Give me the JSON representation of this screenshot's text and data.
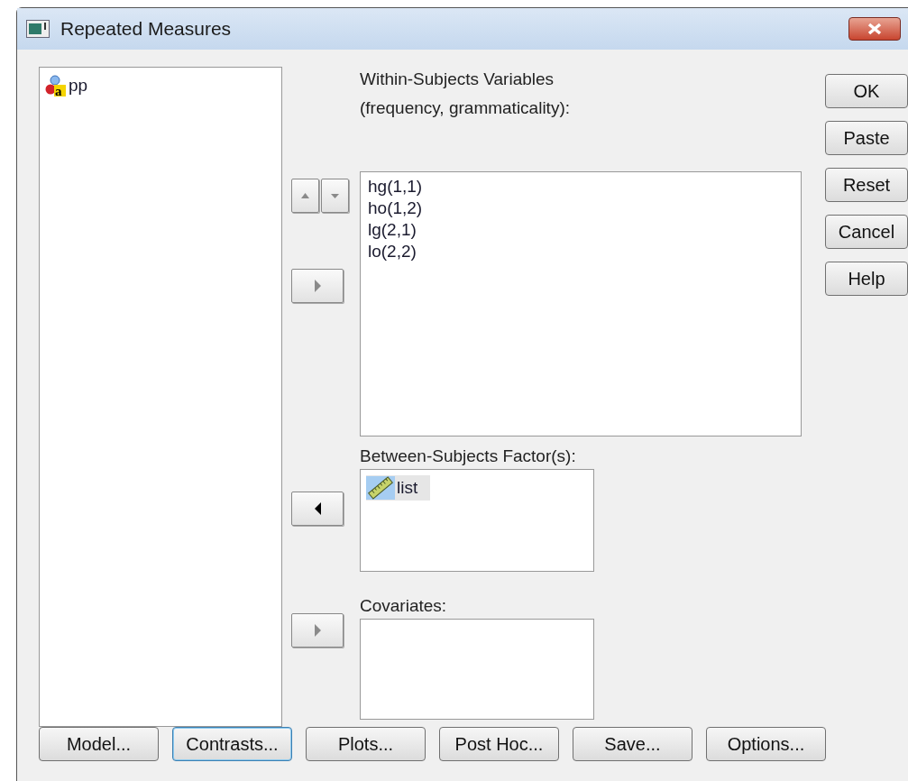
{
  "window": {
    "title": "Repeated Measures"
  },
  "source_list": {
    "items": [
      {
        "label": "pp",
        "kind": "string",
        "icon_letter": "a",
        "selected": false
      }
    ]
  },
  "within": {
    "label": "Within-Subjects Variables",
    "sublabel": "(frequency, grammaticality):",
    "reorder_disabled": true,
    "move_disabled": true,
    "items": [
      {
        "label": "hg(1,1)",
        "selected": false
      },
      {
        "label": "ho(1,2)",
        "selected": false
      },
      {
        "label": "lg(2,1)",
        "selected": false
      },
      {
        "label": "lo(2,2)",
        "selected": false
      }
    ]
  },
  "between": {
    "label": "Between-Subjects Factor(s):",
    "points_left": true,
    "move_disabled": false,
    "items": [
      {
        "label": "list",
        "kind": "scale",
        "selected": true
      }
    ]
  },
  "covariates": {
    "label": "Covariates:",
    "points_left": false,
    "move_disabled": true
  },
  "side_buttons": [
    "OK",
    "Paste",
    "Reset",
    "Cancel",
    "Help"
  ],
  "bottom_buttons": [
    {
      "label": "Model...",
      "focused": false
    },
    {
      "label": "Contrasts...",
      "focused": true
    },
    {
      "label": "Plots...",
      "focused": false
    },
    {
      "label": "Post Hoc...",
      "focused": false
    },
    {
      "label": "Save...",
      "focused": false
    },
    {
      "label": "Options...",
      "focused": false
    }
  ]
}
